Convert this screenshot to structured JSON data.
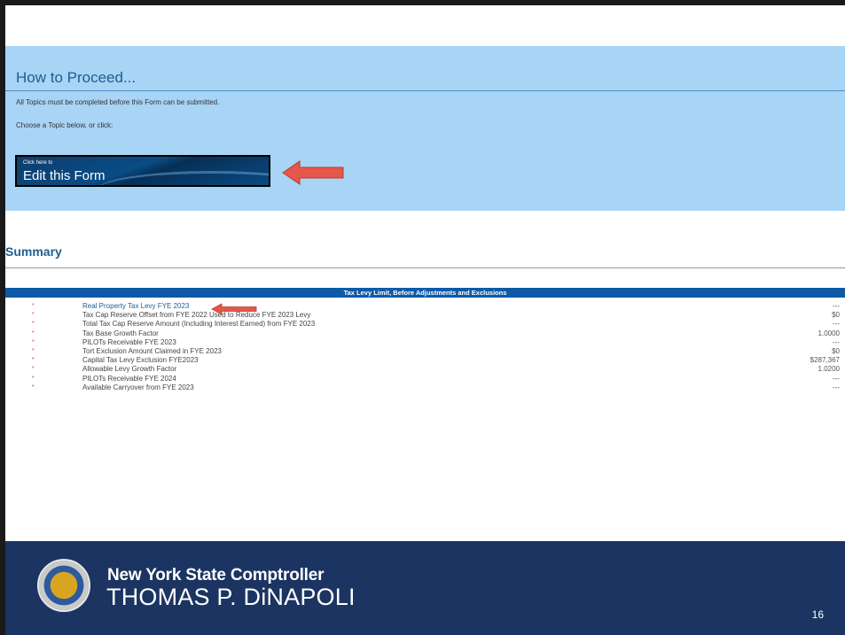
{
  "proceed": {
    "title": "How to Proceed...",
    "line1": "All Topics must be completed before this Form can be submitted.",
    "line2": "Choose a Topic below, or click:",
    "edit_button_small": "Click here to",
    "edit_button_label": "Edit this Form"
  },
  "summary": {
    "title": "Summary",
    "table_header": "Tax Levy Limit, Before Adjustments and Exclusions",
    "rows": [
      {
        "star": "*",
        "label": "Real Property Tax Levy FYE 2023",
        "value": "---"
      },
      {
        "star": "*",
        "label": "Tax Cap Reserve Offset from FYE 2022 Used to Reduce FYE 2023 Levy",
        "value": "$0"
      },
      {
        "star": "*",
        "label": "Total Tax Cap Reserve Amount (Including Interest Earned) from FYE 2023",
        "value": "---"
      },
      {
        "star": "*",
        "label": "Tax Base Growth Factor",
        "value": "1.0000"
      },
      {
        "star": "*",
        "label": "PILOTs Receivable FYE 2023",
        "value": "---"
      },
      {
        "star": "*",
        "label": "Tort Exclusion Amount Claimed in FYE 2023",
        "value": "$0"
      },
      {
        "star": "*",
        "label": "Capital Tax Levy Exclusion FYE2023",
        "value": "$287,367"
      },
      {
        "star": "*",
        "label": "Allowable Levy Growth Factor",
        "value": "1.0200"
      },
      {
        "star": "*",
        "label": "PILOTs Receivable FYE 2024",
        "value": "---"
      },
      {
        "star": "*",
        "label": "Available Carryover from FYE 2023",
        "value": "---"
      }
    ]
  },
  "footer": {
    "line1": "New York State Comptroller",
    "line2": "THOMAS P. DiNAPOLI",
    "page_number": "16"
  },
  "colors": {
    "panel": "#a8d4f5",
    "header_blue": "#0e5aa7",
    "footer_navy": "#1b3461",
    "arrow_red": "#e4574a"
  }
}
